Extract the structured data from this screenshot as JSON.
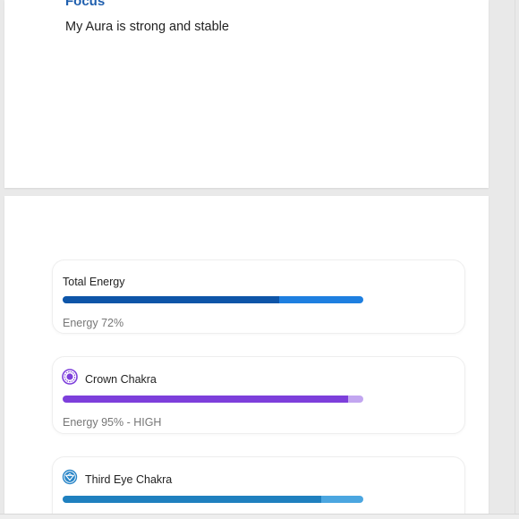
{
  "focus": {
    "title": "Focus",
    "text": "My Aura is strong and stable"
  },
  "energy_cards": [
    {
      "id": "total",
      "title": "Total Energy",
      "status": "Energy 72%",
      "percent": 72,
      "fill_color": "#0e55a8",
      "track_color": "#1e7fe0",
      "icon": null
    },
    {
      "id": "crown",
      "title": "Crown Chakra",
      "status": "Energy 95% - HIGH",
      "percent": 95,
      "fill_color": "#7d3fdb",
      "track_color": "#c2a6f0",
      "icon": "crown-chakra-icon"
    },
    {
      "id": "third-eye",
      "title": "Third Eye Chakra",
      "status": "",
      "percent": 86,
      "fill_color": "#1f80bf",
      "track_color": "#4ba6e0",
      "icon": "third-eye-chakra-icon"
    }
  ]
}
